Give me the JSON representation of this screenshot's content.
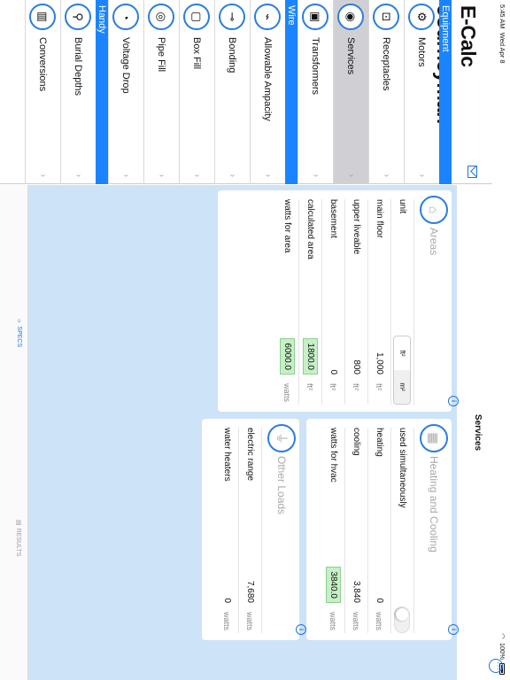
{
  "status": {
    "time": "5:45 AM",
    "date": "Wed Apr 8",
    "battery": "100%"
  },
  "app": {
    "title": "E-Calc Journeyman"
  },
  "menu": [
    {
      "type": "section",
      "label": "Equipment"
    },
    {
      "type": "item",
      "label": "Motors",
      "icon": "motor-icon"
    },
    {
      "type": "item",
      "label": "Receptacles",
      "icon": "receptacle-icon"
    },
    {
      "type": "item",
      "label": "Services",
      "icon": "meter-icon",
      "selected": true
    },
    {
      "type": "item",
      "label": "Transformers",
      "icon": "transformer-icon"
    },
    {
      "type": "section",
      "label": "Wire"
    },
    {
      "type": "item",
      "label": "Allowable Ampacity",
      "icon": "wire-icon"
    },
    {
      "type": "item",
      "label": "Bonding",
      "icon": "bonding-icon"
    },
    {
      "type": "item",
      "label": "Box Fill",
      "icon": "box-icon"
    },
    {
      "type": "item",
      "label": "Pipe Fill",
      "icon": "pipe-icon"
    },
    {
      "type": "item",
      "label": "Voltage Drop",
      "icon": "gauge-icon"
    },
    {
      "type": "section",
      "label": "Handy"
    },
    {
      "type": "item",
      "label": "Burial Depths",
      "icon": "shovel-icon"
    },
    {
      "type": "item",
      "label": "Conversions",
      "icon": "calculator-icon"
    }
  ],
  "nav": {
    "title": "Services"
  },
  "areas": {
    "title": "Areas",
    "unit_label": "unit",
    "unit_options": [
      "ft²",
      "m²"
    ],
    "rows": [
      {
        "label": "main floor",
        "value": "1,000",
        "unit": "ft²"
      },
      {
        "label": "upper liveable",
        "value": "800",
        "unit": "ft²"
      },
      {
        "label": "basement",
        "value": "0",
        "unit": "ft²"
      },
      {
        "label": "calculated area",
        "value": "1800.0",
        "unit": "ft²",
        "result": true
      },
      {
        "label": "watts for area",
        "value": "6000.0",
        "unit": "watts",
        "result": true
      }
    ]
  },
  "heating": {
    "title": "Heating and Cooling",
    "toggle_label": "used simultaneously",
    "rows": [
      {
        "label": "heating",
        "value": "0",
        "unit": "watts"
      },
      {
        "label": "cooling",
        "value": "3,840",
        "unit": "watts"
      },
      {
        "label": "watts for hvac",
        "value": "3840.0",
        "unit": "watts",
        "result": true
      }
    ]
  },
  "other": {
    "title": "Other Loads",
    "rows": [
      {
        "label": "electric range",
        "value": "7,680",
        "unit": "watts"
      },
      {
        "label": "water heaters",
        "value": "0",
        "unit": "watts"
      }
    ]
  },
  "tabs": {
    "specs": "SPECS",
    "results": "RESULTS"
  },
  "colors": {
    "accent": "#1a84ff",
    "panel_bg": "#cde3f8",
    "result_bg": "#c6f0c6"
  }
}
